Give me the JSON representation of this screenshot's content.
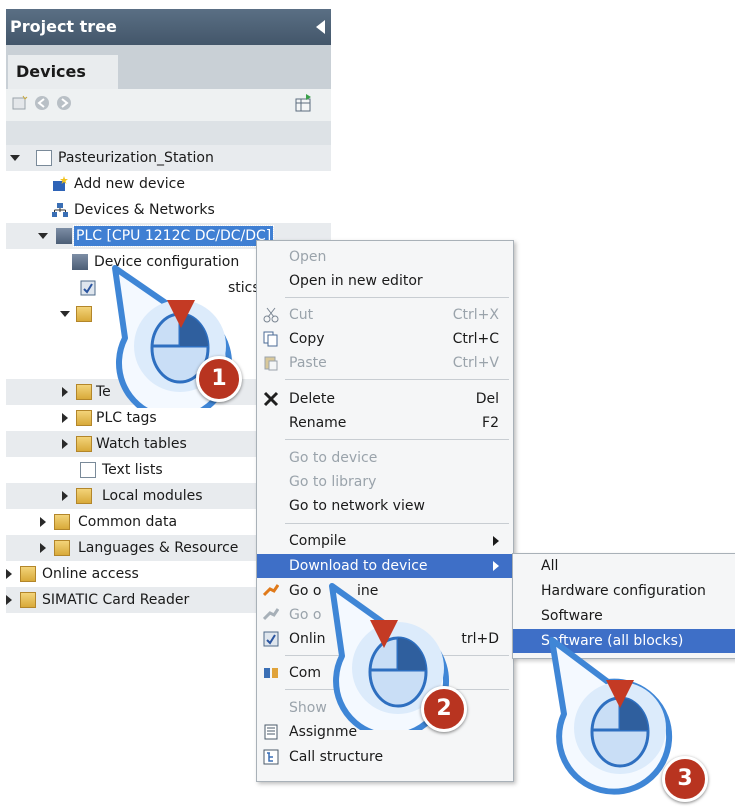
{
  "panel": {
    "title": "Project tree",
    "tab": "Devices"
  },
  "tree": {
    "project": "Pasteurization_Station",
    "add_device": "Add new device",
    "devices_networks": "Devices & Networks",
    "plc": "PLC [CPU 1212C DC/DC/DC]",
    "device_config": "Device configuration",
    "diagnostics_partial": "stics",
    "tech_partial": "Te",
    "plc_tags": "PLC tags",
    "watch_tables": "Watch tables",
    "text_lists": "Text lists",
    "local_modules": "Local modules",
    "common_data": "Common data",
    "languages": "Languages & Resource",
    "online_access": "Online access",
    "card_reader": "SIMATIC Card Reader"
  },
  "menu": {
    "open": "Open",
    "open_new_editor": "Open in new editor",
    "cut": "Cut",
    "cut_sc": "Ctrl+X",
    "copy": "Copy",
    "copy_sc": "Ctrl+C",
    "paste": "Paste",
    "paste_sc": "Ctrl+V",
    "delete": "Delete",
    "delete_sc": "Del",
    "rename": "Rename",
    "rename_sc": "F2",
    "go_device": "Go to device",
    "go_library": "Go to library",
    "go_network": "Go to network view",
    "compile": "Compile",
    "download": "Download to device",
    "go_online_partial": "Go o",
    "go_online_partial2": "ine",
    "go_offline_partial": "Go o",
    "online_diag_partial": "Onlin",
    "online_diag_sc": "trl+D",
    "compare_partial": "Com",
    "show_partial": "Show",
    "assignment_partial": "Assignme",
    "call_structure": "Call structure"
  },
  "submenu": {
    "all": "All",
    "hardware": "Hardware configuration",
    "software": "Software",
    "software_all": "Software (all blocks)"
  },
  "steps": {
    "one": "1",
    "two": "2",
    "three": "3"
  },
  "colors": {
    "title_bar": "#4e6277",
    "selection": "#3e6fc7",
    "callout_blue": "#3f86d6",
    "badge_red": "#b83420"
  }
}
